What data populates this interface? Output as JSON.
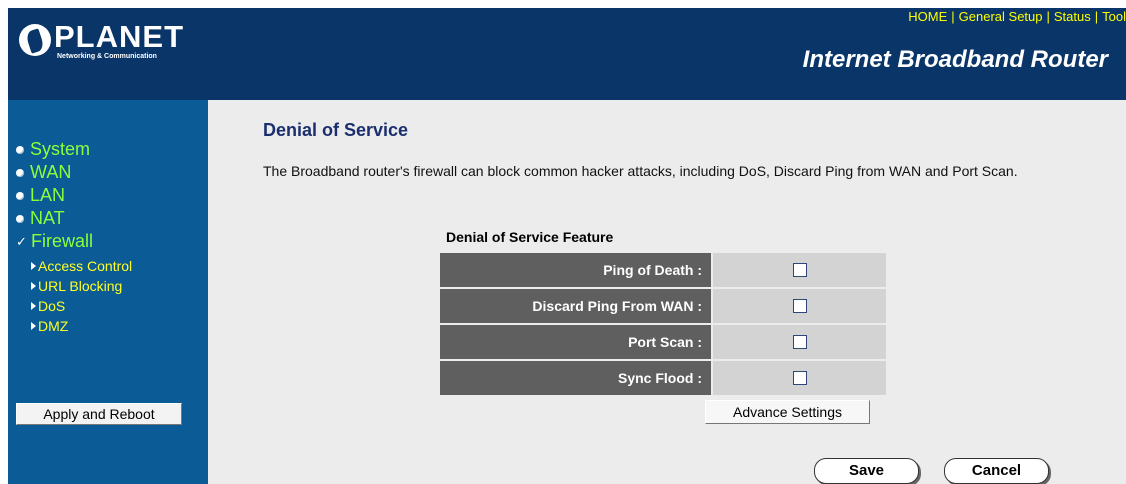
{
  "header": {
    "brand": "PLANET",
    "tagline": "Networking & Communication",
    "nav": [
      "HOME",
      "General Setup",
      "Status",
      "Tool"
    ],
    "nav_separator": "|",
    "product_name": "Internet Broadband Router"
  },
  "sidebar": {
    "items": [
      {
        "label": "System",
        "icon": "radio-bullet-icon"
      },
      {
        "label": "WAN",
        "icon": "radio-bullet-icon"
      },
      {
        "label": "LAN",
        "icon": "radio-bullet-icon"
      },
      {
        "label": "NAT",
        "icon": "radio-bullet-icon"
      },
      {
        "label": "Firewall",
        "icon": "checkmark-icon"
      }
    ],
    "check_glyph": "✓",
    "subitems": [
      {
        "label": "Access Control",
        "icon": "arrow-right-icon"
      },
      {
        "label": "URL Blocking",
        "icon": "arrow-right-icon"
      },
      {
        "label": "DoS",
        "icon": "arrow-right-icon"
      },
      {
        "label": "DMZ",
        "icon": "arrow-right-icon"
      }
    ],
    "reboot_button": "Apply and Reboot"
  },
  "main": {
    "title": "Denial of Service",
    "description": "The Broadband router's firewall can block common hacker attacks, including DoS, Discard Ping from WAN and Port Scan.",
    "feature_heading": "Denial of Service Feature",
    "features": [
      {
        "label": "Ping of Death :",
        "checked": false
      },
      {
        "label": "Discard Ping From WAN :",
        "checked": false
      },
      {
        "label": "Port Scan :",
        "checked": false
      },
      {
        "label": "Sync Flood :",
        "checked": false
      }
    ],
    "advance_button": "Advance Settings",
    "save_button": "Save",
    "cancel_button": "Cancel"
  },
  "colors": {
    "header": "#0a3569",
    "sidebar": "#0a5b96",
    "menu_text": "#8cff3a",
    "submenu_text": "#ffff24",
    "title": "#1b2f6f"
  }
}
